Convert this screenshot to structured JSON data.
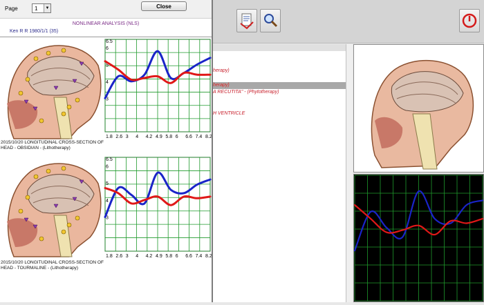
{
  "dialog": {
    "page_label": "Page",
    "page_value": "1",
    "close_label": "Close",
    "report_title": "NONLINEAR ANALYSIS  (NLS)",
    "patient": "Ken R R   1980/1/1 (35)"
  },
  "sections": [
    {
      "caption_line1": "2015/10/20  LONGITUDINAL CROSS-SECTION OF",
      "caption_line2": "HEAD - OBSIDIAN - (Lithotherapy)"
    },
    {
      "caption_line1": "2015/10/20  LONGITUDINAL CROSS-SECTION OF",
      "caption_line2": "HEAD - TOURMALINE - (Lithotherapy)"
    }
  ],
  "list": {
    "rows": [
      {
        "text": "herapy)",
        "state": "normal"
      },
      {
        "text": "",
        "state": "normal"
      },
      {
        "text": "herapy)",
        "state": "selected"
      },
      {
        "text": "A  RECUTITA\" - (Phytotherapy)",
        "state": "normal"
      },
      {
        "text": "",
        "state": "normal"
      },
      {
        "text": "",
        "state": "normal"
      },
      {
        "text": "H VENTRICLE",
        "state": "normal"
      }
    ]
  },
  "toolbar": {
    "icons": [
      "report-icon",
      "search-icon",
      "power-icon"
    ]
  },
  "colors": {
    "blue_series": "#1a24c8",
    "red_series": "#e01818",
    "grid": "#1f9a2c",
    "red_text": "#c8202c",
    "title_purple": "#7a2a86"
  },
  "chart_data": [
    {
      "type": "line",
      "x_ticks": [
        "1.8",
        "2.6",
        "3",
        "4",
        "4.2",
        "4.9",
        "5.8",
        "6",
        "6.6",
        "7.4",
        "8.2"
      ],
      "y_ticks": [
        "3",
        "4",
        "5",
        "6",
        "6.5"
      ],
      "x": [
        1.8,
        2.6,
        3.4,
        4.2,
        5.0,
        5.8,
        6.6,
        7.4,
        8.2
      ],
      "series": [
        {
          "color": "blue",
          "values": [
            3.0,
            4.3,
            4.0,
            4.4,
            5.8,
            4.2,
            4.5,
            5.0,
            5.4
          ]
        },
        {
          "color": "red",
          "values": [
            5.2,
            4.7,
            4.1,
            4.2,
            4.3,
            3.9,
            4.5,
            4.4,
            4.4
          ]
        }
      ],
      "ylim": [
        1.0,
        6.5
      ]
    },
    {
      "type": "line",
      "x_ticks": [
        "1.8",
        "2.6",
        "3",
        "4",
        "4.2",
        "4.9",
        "5.8",
        "6",
        "6.6",
        "7.4",
        "8.2"
      ],
      "y_ticks": [
        "3",
        "4",
        "5",
        "6",
        "6.5"
      ],
      "x": [
        1.8,
        2.6,
        3.4,
        4.2,
        5.0,
        5.8,
        6.6,
        7.4,
        8.2
      ],
      "series": [
        {
          "color": "blue",
          "values": [
            3.0,
            4.7,
            4.3,
            3.8,
            5.6,
            4.6,
            4.4,
            4.9,
            5.2
          ]
        },
        {
          "color": "red",
          "values": [
            4.7,
            4.4,
            3.8,
            4.0,
            4.2,
            3.7,
            4.2,
            4.1,
            4.2
          ]
        }
      ],
      "ylim": [
        1.0,
        6.5
      ]
    },
    {
      "type": "line",
      "x": [
        1.8,
        2.6,
        3.4,
        4.2,
        5.0,
        5.8,
        6.6,
        7.4,
        8.2
      ],
      "series": [
        {
          "color": "blue",
          "values": [
            3.2,
            4.9,
            4.2,
            3.8,
            5.8,
            4.6,
            4.4,
            5.2,
            5.4
          ]
        },
        {
          "color": "red",
          "values": [
            5.2,
            4.6,
            4.0,
            4.1,
            4.3,
            3.9,
            4.5,
            4.4,
            4.6
          ]
        }
      ],
      "ylim": [
        1.0,
        6.5
      ]
    }
  ]
}
